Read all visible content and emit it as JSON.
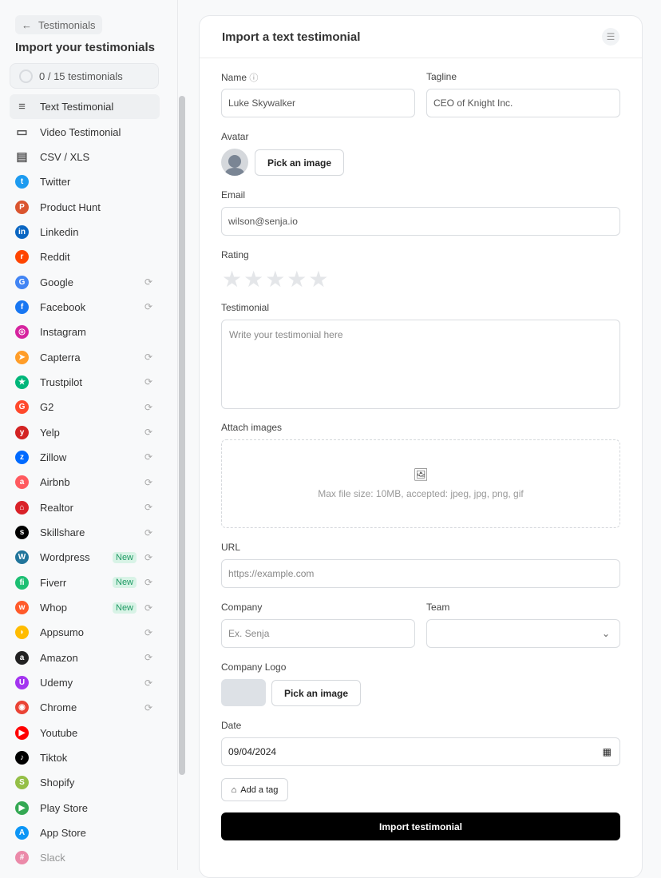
{
  "sidebar": {
    "back_label": "Testimonials",
    "title": "Import your testimonials",
    "progress": "0 / 15 testimonials",
    "items": [
      {
        "label": "Text Testimonial",
        "icon": "lines-icon",
        "color": "#555",
        "glyph": "≡",
        "active": true
      },
      {
        "label": "Video Testimonial",
        "icon": "video-icon",
        "color": "#555",
        "glyph": "▭"
      },
      {
        "label": "CSV / XLS",
        "icon": "file-icon",
        "color": "#555",
        "glyph": "▤"
      },
      {
        "label": "Twitter",
        "icon": "twitter-icon",
        "color": "#1d9bf0",
        "glyph": "t"
      },
      {
        "label": "Product Hunt",
        "icon": "product-hunt-icon",
        "color": "#da552f",
        "glyph": "P"
      },
      {
        "label": "Linkedin",
        "icon": "linkedin-icon",
        "color": "#0a66c2",
        "glyph": "in"
      },
      {
        "label": "Reddit",
        "icon": "reddit-icon",
        "color": "#ff4500",
        "glyph": "r"
      },
      {
        "label": "Google",
        "icon": "google-icon",
        "color": "#4285f4",
        "glyph": "G",
        "sync": true
      },
      {
        "label": "Facebook",
        "icon": "facebook-icon",
        "color": "#1877f2",
        "glyph": "f",
        "sync": true
      },
      {
        "label": "Instagram",
        "icon": "instagram-icon",
        "color": "#d6249f",
        "glyph": "◎"
      },
      {
        "label": "Capterra",
        "icon": "capterra-icon",
        "color": "#ff9d28",
        "glyph": "➤",
        "sync": true
      },
      {
        "label": "Trustpilot",
        "icon": "trustpilot-icon",
        "color": "#00b67a",
        "glyph": "★",
        "sync": true
      },
      {
        "label": "G2",
        "icon": "g2-icon",
        "color": "#ff492c",
        "glyph": "G",
        "sync": true
      },
      {
        "label": "Yelp",
        "icon": "yelp-icon",
        "color": "#d32323",
        "glyph": "y",
        "sync": true
      },
      {
        "label": "Zillow",
        "icon": "zillow-icon",
        "color": "#006aff",
        "glyph": "z",
        "sync": true
      },
      {
        "label": "Airbnb",
        "icon": "airbnb-icon",
        "color": "#ff5a5f",
        "glyph": "a",
        "sync": true
      },
      {
        "label": "Realtor",
        "icon": "realtor-icon",
        "color": "#d92228",
        "glyph": "⌂",
        "sync": true
      },
      {
        "label": "Skillshare",
        "icon": "skillshare-icon",
        "color": "#000",
        "glyph": "s",
        "sync": true
      },
      {
        "label": "Wordpress",
        "icon": "wordpress-icon",
        "color": "#21759b",
        "glyph": "W",
        "badge": "New",
        "sync": true
      },
      {
        "label": "Fiverr",
        "icon": "fiverr-icon",
        "color": "#1dbf73",
        "glyph": "fi",
        "badge": "New",
        "sync": true
      },
      {
        "label": "Whop",
        "icon": "whop-icon",
        "color": "#ff5a2a",
        "glyph": "w",
        "badge": "New",
        "sync": true
      },
      {
        "label": "Appsumo",
        "icon": "appsumo-icon",
        "color": "#ffbc00",
        "glyph": "◗",
        "sync": true
      },
      {
        "label": "Amazon",
        "icon": "amazon-icon",
        "color": "#222",
        "glyph": "a",
        "sync": true
      },
      {
        "label": "Udemy",
        "icon": "udemy-icon",
        "color": "#a435f0",
        "glyph": "U",
        "sync": true
      },
      {
        "label": "Chrome",
        "icon": "chrome-icon",
        "color": "#ea4335",
        "glyph": "◉",
        "sync": true
      },
      {
        "label": "Youtube",
        "icon": "youtube-icon",
        "color": "#ff0000",
        "glyph": "▶"
      },
      {
        "label": "Tiktok",
        "icon": "tiktok-icon",
        "color": "#000",
        "glyph": "♪"
      },
      {
        "label": "Shopify",
        "icon": "shopify-icon",
        "color": "#95bf47",
        "glyph": "S"
      },
      {
        "label": "Play Store",
        "icon": "play-store-icon",
        "color": "#34a853",
        "glyph": "▶"
      },
      {
        "label": "App Store",
        "icon": "app-store-icon",
        "color": "#0d96f6",
        "glyph": "A"
      },
      {
        "label": "Slack",
        "icon": "slack-icon",
        "color": "#e01e5a",
        "glyph": "#"
      }
    ]
  },
  "form": {
    "title": "Import a text testimonial",
    "name_label": "Name",
    "name_value": "Luke Skywalker",
    "tagline_label": "Tagline",
    "tagline_value": "CEO of Knight Inc.",
    "avatar_label": "Avatar",
    "pick_image": "Pick an image",
    "email_label": "Email",
    "email_value": "wilson@senja.io",
    "rating_label": "Rating",
    "rating_value": 0,
    "stars": "★★★★★",
    "testimonial_label": "Testimonial",
    "testimonial_placeholder": "Write your testimonial here",
    "attach_label": "Attach images",
    "attach_hint": "Max file size: 10MB, accepted: jpeg, jpg, png, gif",
    "url_label": "URL",
    "url_placeholder": "https://example.com",
    "company_label": "Company",
    "company_placeholder": "Ex. Senja",
    "team_label": "Team",
    "team_value": "",
    "logo_label": "Company Logo",
    "logo_pick": "Pick an image",
    "date_label": "Date",
    "date_value": "09/04/2024",
    "tag_label": "Add a tag",
    "submit": "Import testimonial"
  }
}
